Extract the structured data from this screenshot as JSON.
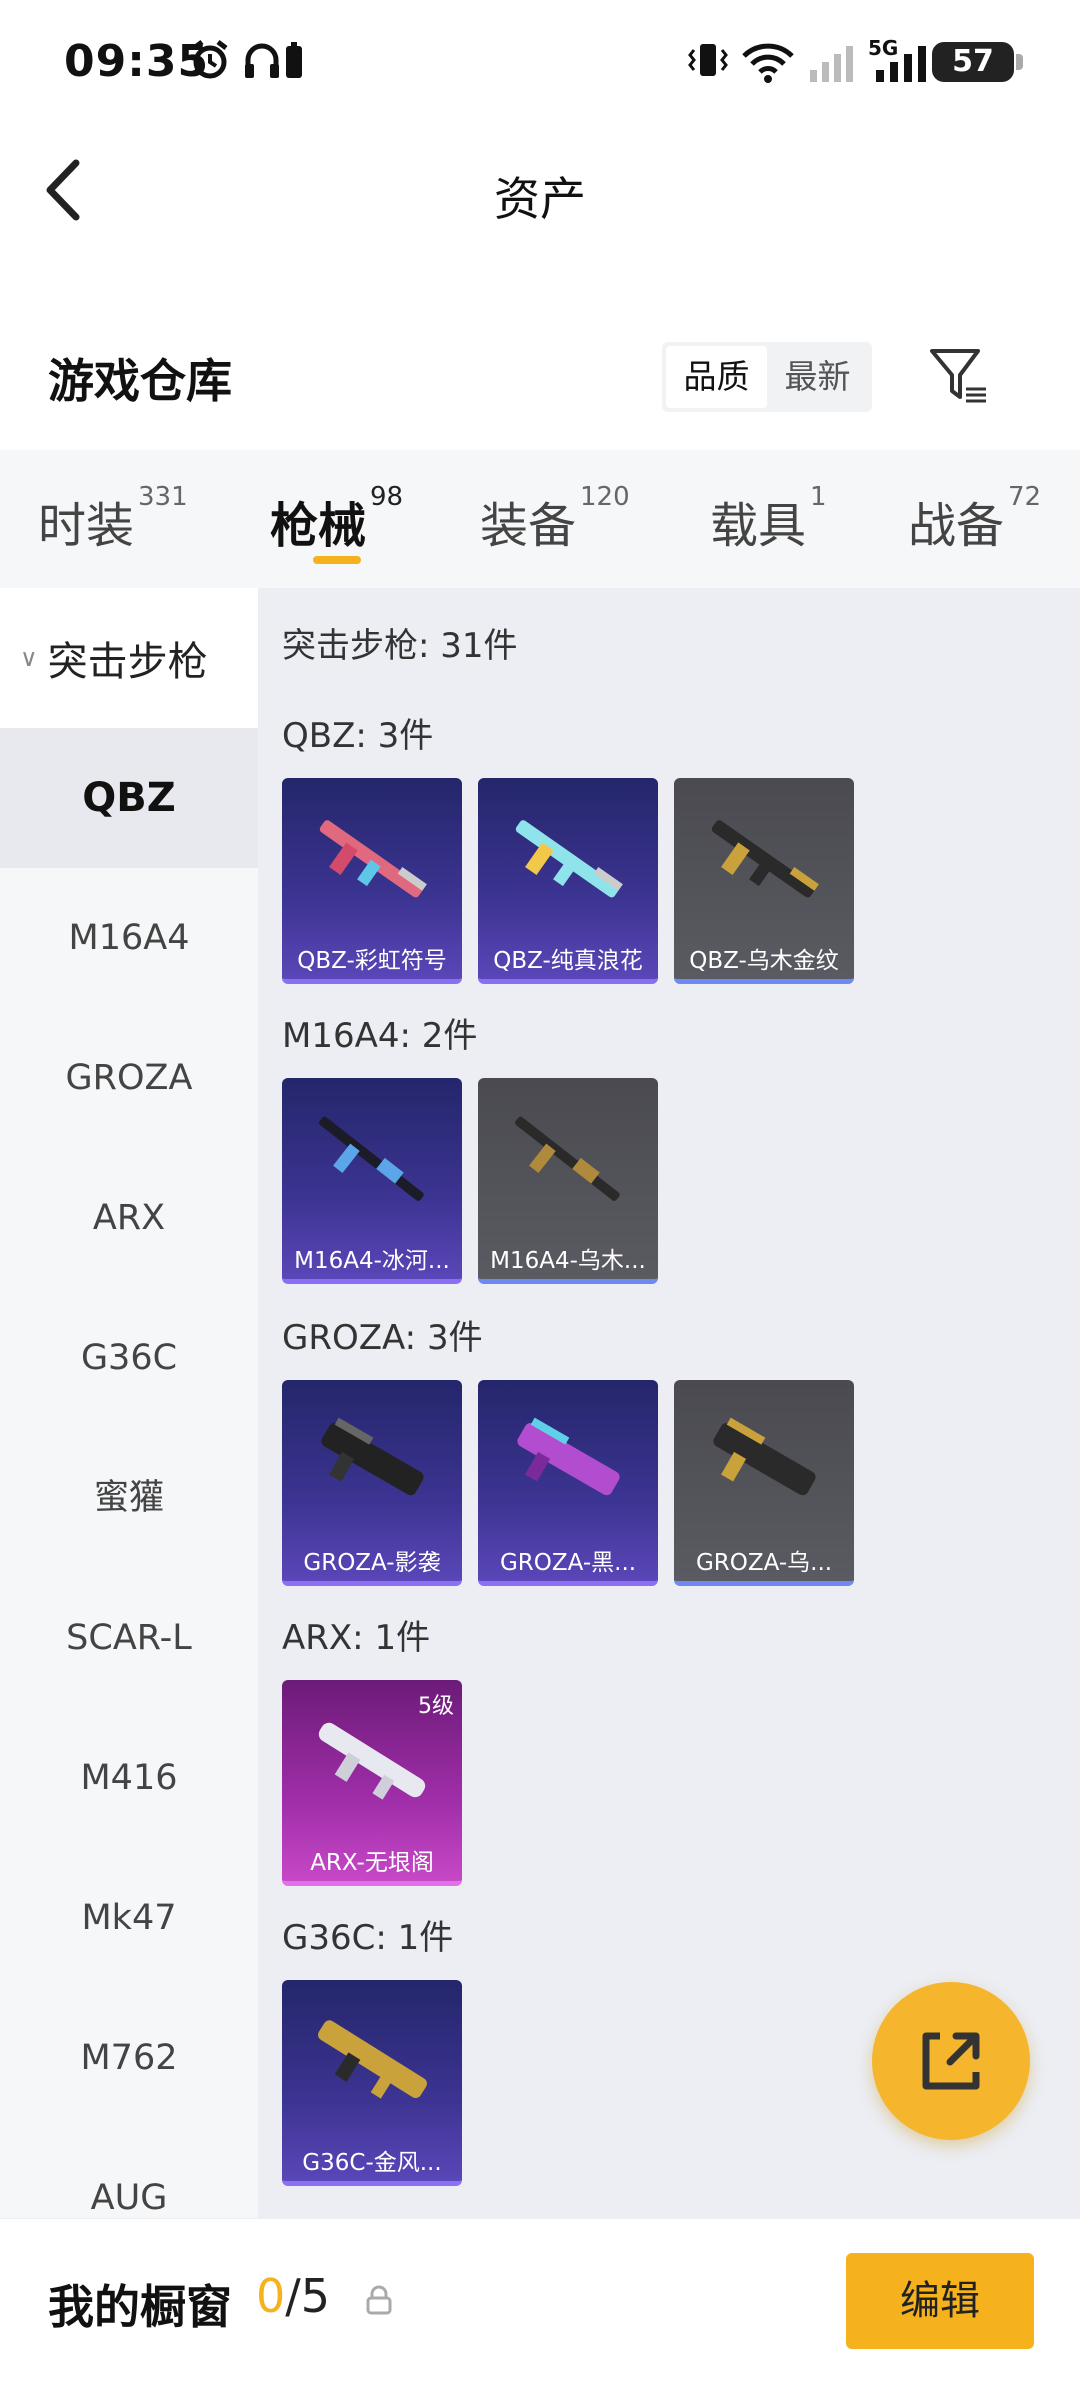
{
  "status_bar": {
    "time": "09:35",
    "battery": "57",
    "network": "5G",
    "icons": [
      "alarm-icon",
      "headphones-icon",
      "vibrate-icon",
      "wifi-icon",
      "signal-icon"
    ]
  },
  "navbar": {
    "title": "资产"
  },
  "warehouse": {
    "title": "游戏仓库"
  },
  "sort": {
    "options": [
      "品质",
      "最新"
    ],
    "selected": "品质"
  },
  "tabs": [
    {
      "label": "时装",
      "count": "331"
    },
    {
      "label": "枪械",
      "count": "98"
    },
    {
      "label": "装备",
      "count": "120"
    },
    {
      "label": "载具",
      "count": "1"
    },
    {
      "label": "战备",
      "count": "72"
    }
  ],
  "active_tab": "枪械",
  "sidebar": {
    "group": "突击步枪",
    "items": [
      "QBZ",
      "M16A4",
      "GROZA",
      "ARX",
      "G36C",
      "蜜獾",
      "SCAR-L",
      "M416",
      "Mk47",
      "M762",
      "AUG"
    ],
    "selected": "QBZ"
  },
  "content": {
    "total": "突击步枪: 31件",
    "sections": [
      {
        "title": "QBZ: 3件",
        "cards": [
          {
            "name": "QBZ-彩虹符号",
            "rarity": "purple"
          },
          {
            "name": "QBZ-纯真浪花",
            "rarity": "purple"
          },
          {
            "name": "QBZ-乌木金纹",
            "rarity": "grey"
          }
        ]
      },
      {
        "title": "M16A4: 2件",
        "cards": [
          {
            "name": "M16A4-冰河...",
            "rarity": "purple"
          },
          {
            "name": "M16A4-乌木...",
            "rarity": "grey"
          }
        ]
      },
      {
        "title": "GROZA: 3件",
        "cards": [
          {
            "name": "GROZA-影袭",
            "rarity": "purple"
          },
          {
            "name": "GROZA-黑...",
            "rarity": "purple"
          },
          {
            "name": "GROZA-乌...",
            "rarity": "grey"
          }
        ]
      },
      {
        "title": "ARX: 1件",
        "cards": [
          {
            "name": "ARX-无垠阁",
            "rarity": "pink",
            "level": "5级"
          }
        ]
      },
      {
        "title": "G36C: 1件",
        "cards": [
          {
            "name": "G36C-金风...",
            "rarity": "purple"
          }
        ]
      }
    ]
  },
  "showcase": {
    "label": "我的橱窗",
    "current": "0",
    "total": "/5"
  },
  "edit_button": "编辑",
  "colors": {
    "accent": "#f5b21c",
    "purple_card": "#3c3492",
    "grey_card": "#55555c",
    "pink_card": "#a02ea9"
  }
}
